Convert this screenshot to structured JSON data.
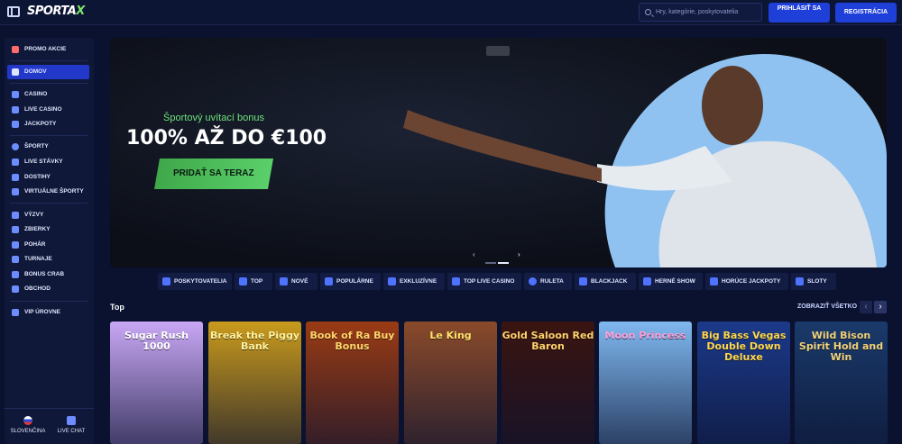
{
  "header": {
    "logo_main": "SPORTA",
    "logo_accent": "X",
    "search_placeholder": "Hry, kategórie, poskytovatelia",
    "login_label": "PRIHLÁSIŤ SA",
    "register_label": "REGISTRÁCIA"
  },
  "sidebar": {
    "items": [
      {
        "label": "PROMO AKCIE",
        "icon": "gift-icon"
      },
      {
        "label": "DOMOV",
        "icon": "home-icon"
      },
      {
        "label": "CASINO",
        "icon": "cards-icon"
      },
      {
        "label": "LIVE CASINO",
        "icon": "live-casino-icon"
      },
      {
        "label": "JACKPOTY",
        "icon": "clover-icon"
      },
      {
        "label": "ŠPORTY",
        "icon": "ball-icon"
      },
      {
        "label": "LIVE STÁVKY",
        "icon": "live-icon"
      },
      {
        "label": "DOSTIHY",
        "icon": "horse-icon"
      },
      {
        "label": "VIRTUÁLNE ŠPORTY",
        "icon": "monitor-icon"
      },
      {
        "label": "VÝZVY",
        "icon": "target-icon"
      },
      {
        "label": "ZBIERKY",
        "icon": "collection-icon"
      },
      {
        "label": "POHÁR",
        "icon": "trophy-icon"
      },
      {
        "label": "TURNAJE",
        "icon": "tournament-icon"
      },
      {
        "label": "BONUS CRAB",
        "icon": "crab-icon"
      },
      {
        "label": "OBCHOD",
        "icon": "shop-icon"
      },
      {
        "label": "VIP ÚROVNE",
        "icon": "vip-icon"
      }
    ],
    "footer_language": "SLOVENČINA",
    "footer_chat": "LIVE CHAT"
  },
  "banner": {
    "subtitle": "Športový uvítací bonus",
    "headline": "100% AŽ DO €100",
    "cta_label": "PRIDAŤ SA TERAZ"
  },
  "categories": [
    {
      "label": "POSKYTOVATELIA",
      "icon": "providers-icon"
    },
    {
      "label": "TOP",
      "icon": "bolt-icon"
    },
    {
      "label": "NOVÉ",
      "icon": "star-icon"
    },
    {
      "label": "POPULÁRNE",
      "icon": "flame-icon"
    },
    {
      "label": "EXKLUZÍVNE",
      "icon": "diamond-icon"
    },
    {
      "label": "TOP LIVE CASINO",
      "icon": "live-casino-icon"
    },
    {
      "label": "RULETA",
      "icon": "roulette-icon"
    },
    {
      "label": "BLACKJACK",
      "icon": "blackjack-icon"
    },
    {
      "label": "HERNÉ SHOW",
      "icon": "show-icon"
    },
    {
      "label": "HORÚCE JACKPOTY",
      "icon": "jackpot-icon"
    },
    {
      "label": "SLOTY",
      "icon": "slot-icon"
    }
  ],
  "top_section": {
    "title": "Top",
    "see_all": "ZOBRAZIŤ VŠETKO"
  },
  "games": [
    {
      "title": "Sugar Rush 1000",
      "bg": "#c9a7f5",
      "fg": "#ffffff"
    },
    {
      "title": "Break the Piggy Bank",
      "bg": "#c99a1c",
      "fg": "#fff2a0"
    },
    {
      "title": "Book of Ra Buy Bonus",
      "bg": "#9a3b14",
      "fg": "#ffd56a"
    },
    {
      "title": "Le King",
      "bg": "#8a4a2a",
      "fg": "#ffe26a"
    },
    {
      "title": "Gold Saloon Red Baron",
      "bg": "#3a1410",
      "fg": "#ffd36b"
    },
    {
      "title": "Moon Princess",
      "bg": "#7fb8f0",
      "fg": "#ff9fd8"
    },
    {
      "title": "Big Bass Vegas Double Down Deluxe",
      "bg": "#1c3a8a",
      "fg": "#ffd84a"
    },
    {
      "title": "Wild Bison Spirit Hold and Win",
      "bg": "#1a3a6a",
      "fg": "#f2d27a"
    }
  ],
  "colors": {
    "accent": "#2138c9",
    "green": "#5ad06a",
    "bg": "#0b1230"
  }
}
